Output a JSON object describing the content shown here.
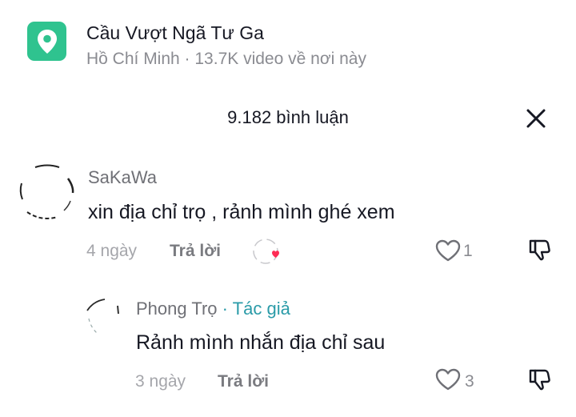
{
  "location": {
    "name": "Cầu Vượt Ngã Tư Ga",
    "subtitle": "Hồ Chí Minh · 13.7K video về nơi này"
  },
  "comments_header": {
    "count_label": "9.182 bình luận"
  },
  "comments": [
    {
      "username": "SaKaWa",
      "text": "xin địa chỉ trọ , rảnh mình ghé xem",
      "time": "4 ngày",
      "reply_label": "Trả lời",
      "likes": "1"
    }
  ],
  "replies": [
    {
      "username": "Phong Trọ",
      "author_tag": " · Tác giả",
      "text": "Rảnh mình nhắn địa chỉ sau",
      "time": "3 ngày",
      "reply_label": "Trả lời",
      "likes": "3"
    }
  ],
  "colors": {
    "pin_badge": "#2fc38f",
    "author_tag": "#2a9ba8",
    "heart": "#fe2c55"
  },
  "icons": [
    "location-pin-icon",
    "close-icon",
    "heart-outline-icon",
    "dislike-icon",
    "creator-liked-heart-icon"
  ]
}
